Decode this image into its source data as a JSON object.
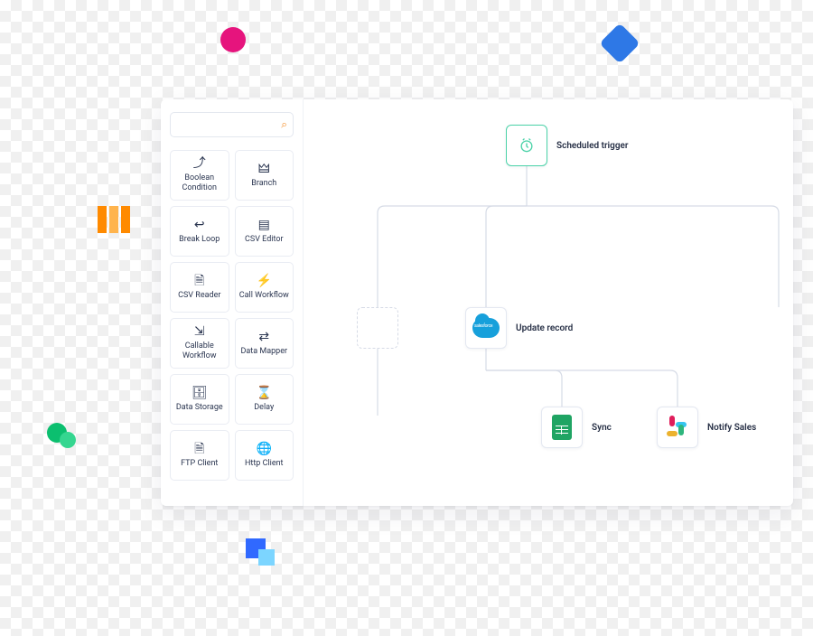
{
  "search": {
    "placeholder": ""
  },
  "palette": [
    {
      "label": "Boolean Condition",
      "icon": "⤴"
    },
    {
      "label": "Branch",
      "icon": "🜲"
    },
    {
      "label": "Break Loop",
      "icon": "↩"
    },
    {
      "label": "CSV Editor",
      "icon": "▤"
    },
    {
      "label": "CSV Reader",
      "icon": "🗎"
    },
    {
      "label": "Call Workflow",
      "icon": "⚡"
    },
    {
      "label": "Callable Workflow",
      "icon": "⇲"
    },
    {
      "label": "Data Mapper",
      "icon": "⇄"
    },
    {
      "label": "Data Storage",
      "icon": "🗄"
    },
    {
      "label": "Delay",
      "icon": "⌛"
    },
    {
      "label": "FTP Client",
      "icon": "🗎"
    },
    {
      "label": "Http Client",
      "icon": "🌐"
    }
  ],
  "nodes": {
    "trigger": {
      "label": "Scheduled trigger"
    },
    "update": {
      "label": "Update record"
    },
    "sync": {
      "label": "Sync"
    },
    "notify": {
      "label": "Notify Sales"
    }
  }
}
